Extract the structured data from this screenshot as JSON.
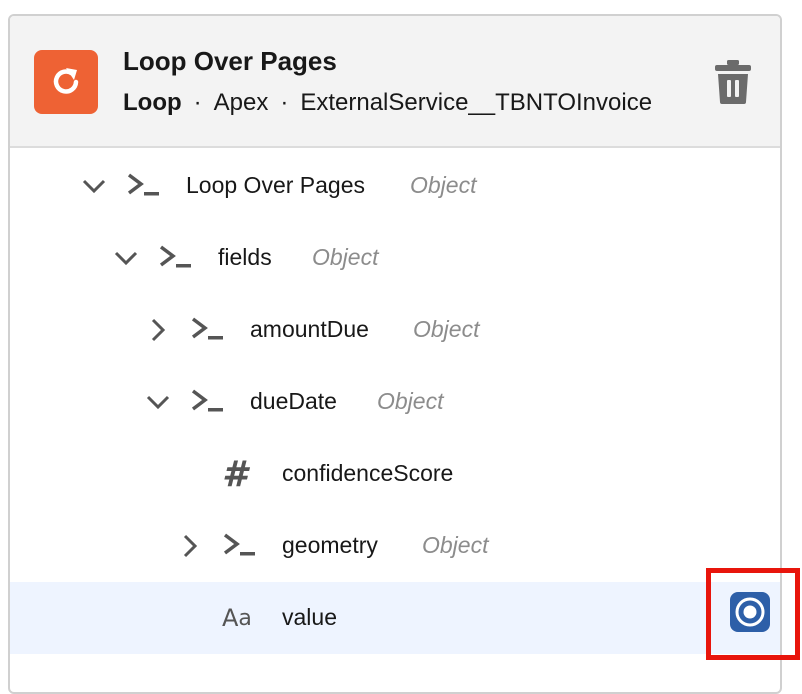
{
  "header": {
    "title": "Loop Over Pages",
    "subtitle_type": "Loop",
    "separator": "·",
    "subtitle_lang": "Apex",
    "subtitle_source": "ExternalService__TBNTOInvoice",
    "icon": "loop-icon",
    "accent": "#ee6234"
  },
  "tree": [
    {
      "label": "Loop Over Pages",
      "type": "Object",
      "expanded": true
    },
    {
      "label": "fields",
      "type": "Object",
      "expanded": true
    },
    {
      "label": "amountDue",
      "type": "Object",
      "expanded": false
    },
    {
      "label": "dueDate",
      "type": "Object",
      "expanded": true
    },
    {
      "label": "confidenceScore",
      "type": "",
      "icon": "number-icon"
    },
    {
      "label": "geometry",
      "type": "Object",
      "expanded": false
    },
    {
      "label": "value",
      "type": "",
      "icon": "text-icon",
      "selected": true
    }
  ],
  "colors": {
    "selected_row": "#eef4ff",
    "target_button": "#2d5fa8",
    "highlight": "#e8150c"
  }
}
